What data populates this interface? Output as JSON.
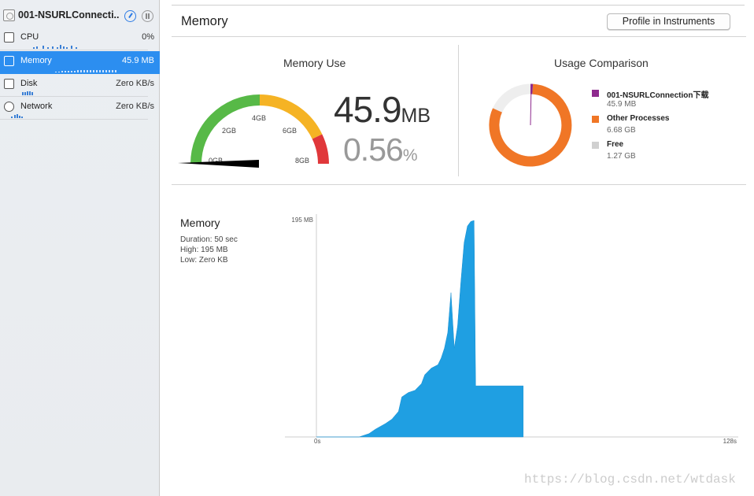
{
  "sidebar": {
    "app_name": "001-NSURLConnecti...",
    "gauges": [
      {
        "label": "CPU",
        "value": "0%"
      },
      {
        "label": "Memory",
        "value": "45.9 MB"
      },
      {
        "label": "Disk",
        "value": "Zero KB/s"
      },
      {
        "label": "Network",
        "value": "Zero KB/s"
      }
    ]
  },
  "header": {
    "title": "Memory",
    "profile_button": "Profile in Instruments"
  },
  "memory_use": {
    "title": "Memory Use",
    "gauge_labels": [
      "0GB",
      "2GB",
      "4GB",
      "6GB",
      "8GB"
    ],
    "value_number": "45.9",
    "value_unit": "MB",
    "percent_number": "0.56",
    "percent_unit": "%",
    "colors": {
      "green": "#57b947",
      "yellow": "#f5b324",
      "red": "#e0373a"
    }
  },
  "usage_comparison": {
    "title": "Usage Comparison",
    "legend": [
      {
        "name": "001-NSURLConnection下载",
        "value": "45.9 MB",
        "color": "#8e2a8e"
      },
      {
        "name": "Other Processes",
        "value": "6.68 GB",
        "color": "#f07626"
      },
      {
        "name": "Free",
        "value": "1.27 GB",
        "color": "#d0d0d0"
      }
    ]
  },
  "memory_graph": {
    "title": "Memory",
    "duration": "Duration: 50 sec",
    "high": "High: 195 MB",
    "low": "Low: Zero KB"
  },
  "chart_data": {
    "type": "area",
    "y_max_label": "195 MB",
    "x_start_label": "0s",
    "x_end_label": "128s",
    "xlim": [
      0,
      128
    ],
    "ylim": [
      0,
      195
    ],
    "color": "#1f9fe2",
    "x": [
      0,
      13,
      16,
      18,
      21,
      23,
      25,
      26,
      28,
      30,
      32,
      33,
      35,
      37,
      38,
      39,
      40,
      41,
      42,
      43,
      44,
      45,
      46,
      47,
      48,
      48.5,
      50,
      50.1,
      63
    ],
    "values": [
      0,
      0,
      3,
      7,
      12,
      16,
      23,
      36,
      40,
      42,
      48,
      56,
      62,
      65,
      71,
      80,
      94,
      130,
      80,
      100,
      140,
      175,
      190,
      194,
      195,
      46,
      46,
      46,
      46
    ]
  },
  "watermark": "https://blog.csdn.net/wtdask"
}
